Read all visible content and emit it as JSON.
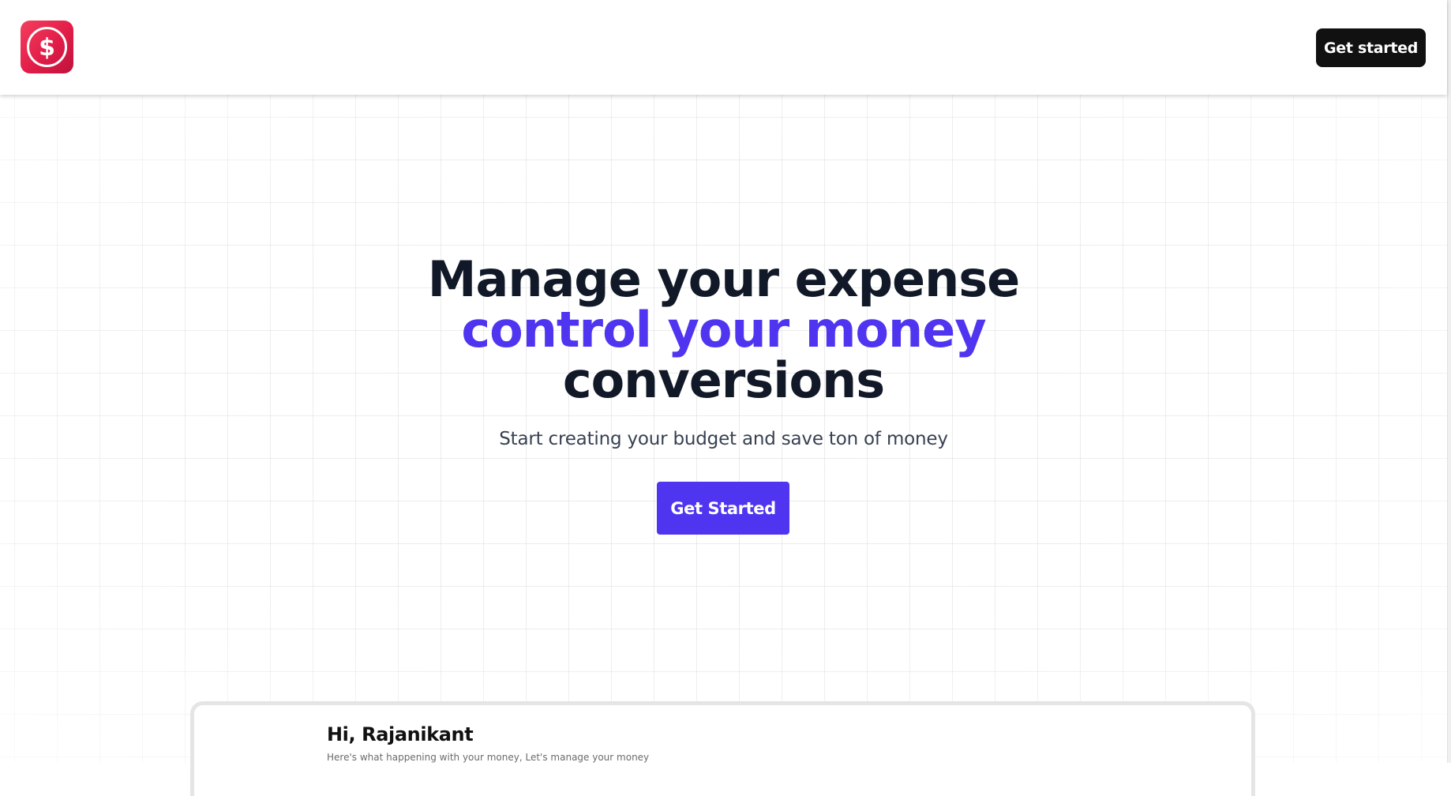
{
  "header": {
    "logo_icon": "dollar-circle-icon",
    "get_started_label": "Get started"
  },
  "hero": {
    "line1": "Manage your expense",
    "line2": "control your money",
    "line3": "conversions",
    "subtitle": "Start creating your budget and save ton of money",
    "cta_label": "Get Started"
  },
  "preview": {
    "greeting": "Hi, Rajanikant",
    "subtitle": "Here's what happening with your money, Let's manage your money"
  },
  "colors": {
    "accent": "#4f35f0",
    "dark": "#111827",
    "logo": "#e11d48"
  }
}
